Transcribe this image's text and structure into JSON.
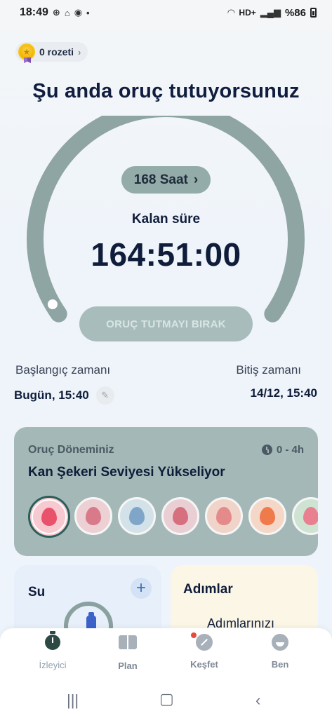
{
  "status_bar": {
    "time": "18:49",
    "battery": "%86",
    "network": "HD+"
  },
  "badge": {
    "label": "0 rozeti"
  },
  "header": {
    "title": "Şu anda oruç tutuyorsunuz"
  },
  "timer": {
    "plan_hours": "168 Saat",
    "remaining_label": "Kalan süre",
    "remaining_time": "164:51:00",
    "stop_button": "ORUÇ TUTMAYI BIRAK",
    "progress_fraction": 0.02
  },
  "times": {
    "start_label": "Başlangıç zamanı",
    "start_value": "Bugün, 15:40",
    "end_label": "Bitiş zamanı",
    "end_value": "14/12, 15:40"
  },
  "period_card": {
    "label": "Oruç Döneminiz",
    "range": "0 - 4h",
    "title": "Kan Şekeri Seviyesi Yükseliyor",
    "stages": [
      {
        "name": "blood-sugar-rising-icon",
        "color": "#e8536b",
        "bg": "#f7c9d0"
      },
      {
        "name": "blood-sugar-falling-icon",
        "color": "#d87a8a",
        "bg": "#ecd0d4"
      },
      {
        "name": "insulin-balance-icon",
        "color": "#7fa6c9",
        "bg": "#d3e2e9"
      },
      {
        "name": "fat-burning-start-icon",
        "color": "#d6707e",
        "bg": "#e9cfd3"
      },
      {
        "name": "ketosis-icon",
        "color": "#e58a8a",
        "bg": "#f0d3c9"
      },
      {
        "name": "fire-burning-icon",
        "color": "#ef7a4c",
        "bg": "#f5d7c8"
      },
      {
        "name": "autophagy-icon",
        "color": "#e88090",
        "bg": "#cfe3d2"
      }
    ]
  },
  "water_card": {
    "title": "Su",
    "add_label": "+"
  },
  "steps_card": {
    "title": "Adımlar",
    "subtitle": "Adımlarınızı"
  },
  "bottom_nav": {
    "items": [
      {
        "label": "İzleyici",
        "active": true
      },
      {
        "label": "Plan",
        "active": false
      },
      {
        "label": "Keşfet",
        "active": false
      },
      {
        "label": "Ben",
        "active": false
      }
    ]
  },
  "colors": {
    "ring": "#8ea5a3",
    "card": "#a4b9b7",
    "title": "#101d3f",
    "accent_blue": "#3a62c9"
  }
}
